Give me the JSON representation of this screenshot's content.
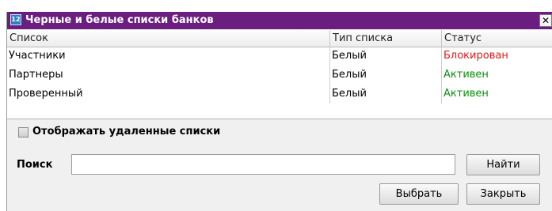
{
  "window": {
    "title": "Черные и белые списки банков",
    "app_icon": "12",
    "close_glyph": "✕"
  },
  "table": {
    "columns": [
      "Список",
      "Тип списка",
      "Статус"
    ],
    "rows": [
      {
        "name": "Участники",
        "type": "Белый",
        "status": "Блокирован",
        "status_color": "#e01818"
      },
      {
        "name": "Партнеры",
        "type": "Белый",
        "status": "Активен",
        "status_color": "#0b8f0b"
      },
      {
        "name": "Проверенный",
        "type": "Белый",
        "status": "Активен",
        "status_color": "#0b8f0b"
      }
    ]
  },
  "options": {
    "show_deleted_label": "Отображать удаленные списки",
    "show_deleted_checked": false
  },
  "search": {
    "label": "Поиск",
    "value": "",
    "find_button": "Найти"
  },
  "footer": {
    "select_button": "Выбрать",
    "close_button": "Закрыть"
  }
}
